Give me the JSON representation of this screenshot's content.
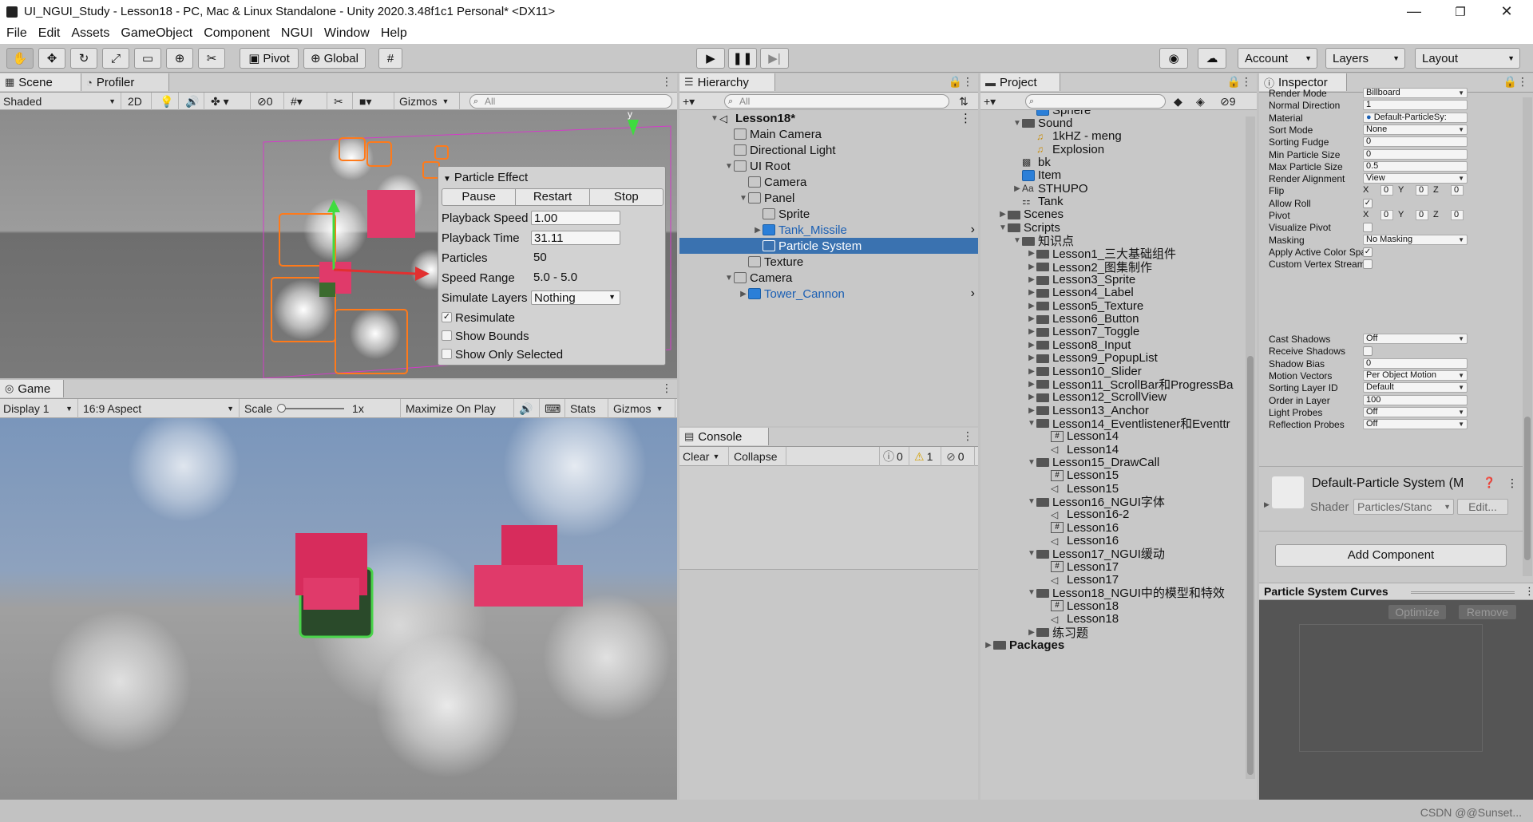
{
  "window": {
    "title": "UI_NGUI_Study - Lesson18 - PC, Mac & Linux Standalone - Unity 2020.3.48f1c1 Personal* <DX11>",
    "minimize": "—",
    "restore": "❐",
    "close": "✕"
  },
  "menu": [
    "File",
    "Edit",
    "Assets",
    "GameObject",
    "Component",
    "NGUI",
    "Window",
    "Help"
  ],
  "toolbar": {
    "pivot": "Pivot",
    "global": "Global",
    "account": "Account",
    "layers": "Layers",
    "layout": "Layout"
  },
  "scene": {
    "tab_scene": "Scene",
    "tab_profiler": "Profiler",
    "shading": "Shaded",
    "mode2d": "2D",
    "hidden_count": "0",
    "gizmos": "Gizmos",
    "search_placeholder": "All",
    "axis_y": "y"
  },
  "particle_effect": {
    "title": "Particle Effect",
    "pause": "Pause",
    "restart": "Restart",
    "stop": "Stop",
    "rows": [
      {
        "label": "Playback Speed",
        "value": "1.00"
      },
      {
        "label": "Playback Time",
        "value": "31.11"
      },
      {
        "label": "Particles",
        "value": "50"
      },
      {
        "label": "Speed Range",
        "value": "5.0 - 5.0"
      },
      {
        "label": "Simulate Layers",
        "value": "Nothing"
      }
    ],
    "resimulate": "Resimulate",
    "show_bounds": "Show Bounds",
    "show_only_selected": "Show Only Selected"
  },
  "game": {
    "tab": "Game",
    "display": "Display 1",
    "aspect": "16:9 Aspect",
    "scale_label": "Scale",
    "scale_value": "1x",
    "maximize": "Maximize On Play",
    "stats": "Stats",
    "gizmos": "Gizmos"
  },
  "hierarchy": {
    "tab": "Hierarchy",
    "search_placeholder": "All",
    "rows": [
      {
        "name": "Lesson18*",
        "depth": 0,
        "arrow": "▼",
        "icon": "unity"
      },
      {
        "name": "Main Camera",
        "depth": 1,
        "arrow": "",
        "icon": "cube"
      },
      {
        "name": "Directional Light",
        "depth": 1,
        "arrow": "",
        "icon": "cube"
      },
      {
        "name": "UI Root",
        "depth": 1,
        "arrow": "▼",
        "icon": "cube"
      },
      {
        "name": "Camera",
        "depth": 2,
        "arrow": "",
        "icon": "cube"
      },
      {
        "name": "Panel",
        "depth": 2,
        "arrow": "▼",
        "icon": "cube"
      },
      {
        "name": "Sprite",
        "depth": 3,
        "arrow": "",
        "icon": "cube"
      },
      {
        "name": "Tank_Missile",
        "depth": 3,
        "arrow": "▶",
        "icon": "prefab"
      },
      {
        "name": "Particle System",
        "depth": 3,
        "arrow": "",
        "icon": "cube"
      },
      {
        "name": "Texture",
        "depth": 2,
        "arrow": "",
        "icon": "cube"
      },
      {
        "name": "Camera",
        "depth": 1,
        "arrow": "▼",
        "icon": "cube"
      },
      {
        "name": "Tower_Cannon",
        "depth": 2,
        "arrow": "▶",
        "icon": "prefab"
      }
    ]
  },
  "console": {
    "tab": "Console",
    "clear": "Clear",
    "collapse": "Collapse",
    "info_count": "0",
    "warn_count": "1",
    "error_count": "0"
  },
  "project": {
    "tab": "Project",
    "hidden_count": "9",
    "rows": [
      {
        "name": "Sphere",
        "depth": 3,
        "arrow": "",
        "icon": "prefab"
      },
      {
        "name": "Sound",
        "depth": 2,
        "arrow": "▼",
        "icon": "folder"
      },
      {
        "name": "1kHZ - meng",
        "depth": 3,
        "arrow": "",
        "icon": "audio"
      },
      {
        "name": "Explosion",
        "depth": 3,
        "arrow": "",
        "icon": "audio"
      },
      {
        "name": "bk",
        "depth": 2,
        "arrow": "",
        "icon": "image"
      },
      {
        "name": "Item",
        "depth": 2,
        "arrow": "",
        "icon": "prefab"
      },
      {
        "name": "STHUPO",
        "depth": 2,
        "arrow": "▶",
        "icon": "font"
      },
      {
        "name": "Tank",
        "depth": 2,
        "arrow": "",
        "icon": "atlas"
      },
      {
        "name": "Scenes",
        "depth": 1,
        "arrow": "▶",
        "icon": "folder"
      },
      {
        "name": "Scripts",
        "depth": 1,
        "arrow": "▼",
        "icon": "folder"
      },
      {
        "name": "知识点",
        "depth": 2,
        "arrow": "▼",
        "icon": "folder"
      },
      {
        "name": "Lesson1_三大基础组件",
        "depth": 3,
        "arrow": "▶",
        "icon": "folder"
      },
      {
        "name": "Lesson2_图集制作",
        "depth": 3,
        "arrow": "▶",
        "icon": "folder"
      },
      {
        "name": "Lesson3_Sprite",
        "depth": 3,
        "arrow": "▶",
        "icon": "folder"
      },
      {
        "name": "Lesson4_Label",
        "depth": 3,
        "arrow": "▶",
        "icon": "folder"
      },
      {
        "name": "Lesson5_Texture",
        "depth": 3,
        "arrow": "▶",
        "icon": "folder"
      },
      {
        "name": "Lesson6_Button",
        "depth": 3,
        "arrow": "▶",
        "icon": "folder"
      },
      {
        "name": "Lesson7_Toggle",
        "depth": 3,
        "arrow": "▶",
        "icon": "folder"
      },
      {
        "name": "Lesson8_Input",
        "depth": 3,
        "arrow": "▶",
        "icon": "folder"
      },
      {
        "name": "Lesson9_PopupList",
        "depth": 3,
        "arrow": "▶",
        "icon": "folder"
      },
      {
        "name": "Lesson10_Slider",
        "depth": 3,
        "arrow": "▶",
        "icon": "folder"
      },
      {
        "name": "Lesson11_ScrollBar和ProgressBa",
        "depth": 3,
        "arrow": "▶",
        "icon": "folder"
      },
      {
        "name": "Lesson12_ScrollView",
        "depth": 3,
        "arrow": "▶",
        "icon": "folder"
      },
      {
        "name": "Lesson13_Anchor",
        "depth": 3,
        "arrow": "▶",
        "icon": "folder"
      },
      {
        "name": "Lesson14_Eventlistener和Eventtr",
        "depth": 3,
        "arrow": "▼",
        "icon": "folder"
      },
      {
        "name": "Lesson14",
        "depth": 4,
        "arrow": "",
        "icon": "script"
      },
      {
        "name": "Lesson14",
        "depth": 4,
        "arrow": "",
        "icon": "scene"
      },
      {
        "name": "Lesson15_DrawCall",
        "depth": 3,
        "arrow": "▼",
        "icon": "folder"
      },
      {
        "name": "Lesson15",
        "depth": 4,
        "arrow": "",
        "icon": "script"
      },
      {
        "name": "Lesson15",
        "depth": 4,
        "arrow": "",
        "icon": "scene"
      },
      {
        "name": "Lesson16_NGUI字体",
        "depth": 3,
        "arrow": "▼",
        "icon": "folder"
      },
      {
        "name": "Lesson16-2",
        "depth": 4,
        "arrow": "",
        "icon": "scene"
      },
      {
        "name": "Lesson16",
        "depth": 4,
        "arrow": "",
        "icon": "script"
      },
      {
        "name": "Lesson16",
        "depth": 4,
        "arrow": "",
        "icon": "scene"
      },
      {
        "name": "Lesson17_NGUI缓动",
        "depth": 3,
        "arrow": "▼",
        "icon": "folder"
      },
      {
        "name": "Lesson17",
        "depth": 4,
        "arrow": "",
        "icon": "script"
      },
      {
        "name": "Lesson17",
        "depth": 4,
        "arrow": "",
        "icon": "scene"
      },
      {
        "name": "Lesson18_NGUI中的模型和特效",
        "depth": 3,
        "arrow": "▼",
        "icon": "folder"
      },
      {
        "name": "Lesson18",
        "depth": 4,
        "arrow": "",
        "icon": "script"
      },
      {
        "name": "Lesson18",
        "depth": 4,
        "arrow": "",
        "icon": "scene"
      },
      {
        "name": "练习题",
        "depth": 3,
        "arrow": "▶",
        "icon": "folder"
      },
      {
        "name": "Packages",
        "depth": 0,
        "arrow": "▶",
        "icon": "folder"
      }
    ]
  },
  "inspector": {
    "tab": "Inspector",
    "rows": [
      {
        "label": "Render Mode",
        "value": "Billboard",
        "type": "dd"
      },
      {
        "label": "Normal Direction",
        "value": "1",
        "type": "field"
      },
      {
        "label": "Material",
        "value": "Default-ParticleSy:",
        "type": "obj"
      },
      {
        "label": "Sort Mode",
        "value": "None",
        "type": "dd"
      },
      {
        "label": "Sorting Fudge",
        "value": "0",
        "type": "field"
      },
      {
        "label": "Min Particle Size",
        "value": "0",
        "type": "field"
      },
      {
        "label": "Max Particle Size",
        "value": "0.5",
        "type": "field"
      },
      {
        "label": "Render Alignment",
        "value": "View",
        "type": "dd"
      },
      {
        "label": "Flip",
        "value": "",
        "type": "xyz",
        "x": "0",
        "y": "0",
        "z": "0"
      },
      {
        "label": "Allow Roll",
        "value": "✓",
        "type": "check"
      },
      {
        "label": "Pivot",
        "value": "",
        "type": "xyz",
        "x": "0",
        "y": "0",
        "z": "0"
      },
      {
        "label": "Visualize Pivot",
        "value": "",
        "type": "check"
      },
      {
        "label": "Masking",
        "value": "No Masking",
        "type": "dd"
      },
      {
        "label": "Apply Active Color Spa",
        "value": "✓",
        "type": "check"
      },
      {
        "label": "Custom Vertex Stream:",
        "value": "",
        "type": "check"
      }
    ],
    "rows2": [
      {
        "label": "Cast Shadows",
        "value": "Off",
        "type": "dd"
      },
      {
        "label": "Receive Shadows",
        "value": "",
        "type": "check"
      },
      {
        "label": "Shadow Bias",
        "value": "0",
        "type": "field"
      },
      {
        "label": "Motion Vectors",
        "value": "Per Object Motion",
        "type": "dd"
      },
      {
        "label": "Sorting Layer ID",
        "value": "Default",
        "type": "dd"
      },
      {
        "label": "Order in Layer",
        "value": "100",
        "type": "field"
      },
      {
        "label": "Light Probes",
        "value": "Off",
        "type": "dd"
      },
      {
        "label": "Reflection Probes",
        "value": "Off",
        "type": "dd"
      }
    ],
    "material_name": "Default-Particle System (M",
    "shader_label": "Shader",
    "shader_value": "Particles/Stanc",
    "edit": "Edit...",
    "add_component": "Add Component",
    "curves_title": "Particle System Curves",
    "optimize": "Optimize",
    "remove": "Remove"
  },
  "watermark": "CSDN @@Sunset...",
  "colors": {
    "selection": "#3a72b0",
    "prefab_text": "#1a5fb4",
    "accent_orange": "#ff7a1a",
    "tank_red": "#d72c5c"
  }
}
